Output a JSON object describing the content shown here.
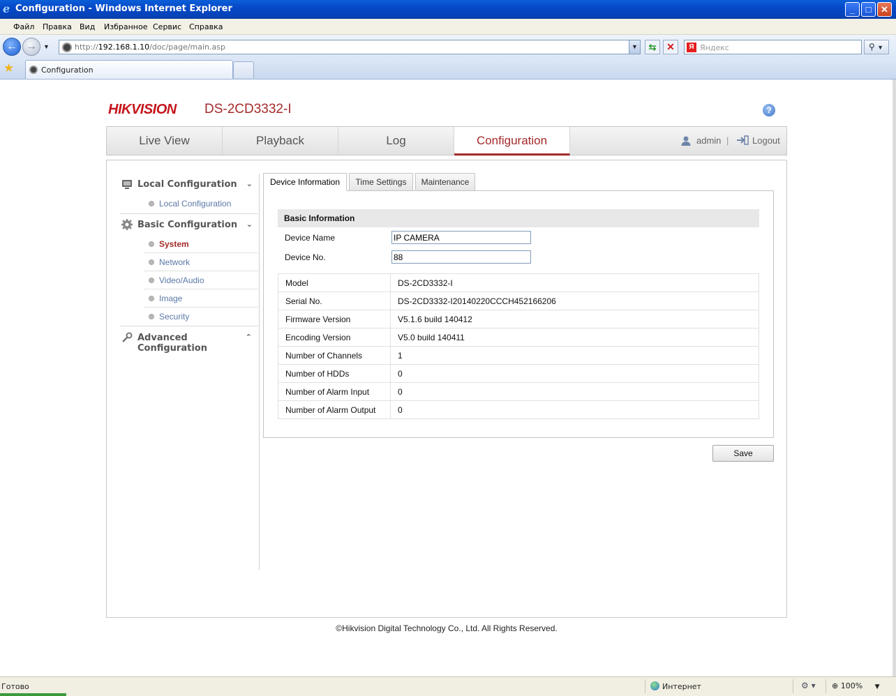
{
  "window": {
    "title": "Configuration - Windows Internet Explorer",
    "minimize": "_",
    "maximize": "□",
    "close": "✕"
  },
  "menu": [
    "Файл",
    "Правка",
    "Вид",
    "Избранное",
    "Сервис",
    "Справка"
  ],
  "address": {
    "prefix": "http://",
    "host": "192.168.1.10",
    "path": "/doc/page/main.asp",
    "search_placeholder": "Яндекс",
    "search_engine_letter": "Я"
  },
  "browser_tab": {
    "label": "Configuration"
  },
  "header": {
    "logo": "HIKVISION",
    "model": "DS-2CD3332-I",
    "help": "?"
  },
  "nav": {
    "tabs": [
      "Live View",
      "Playback",
      "Log",
      "Configuration"
    ],
    "active_index": 3,
    "user": "admin",
    "separator": "|",
    "logout": "Logout"
  },
  "sidebar": {
    "local": {
      "label": "Local Configuration",
      "items": [
        "Local Configuration"
      ]
    },
    "basic": {
      "label": "Basic Configuration",
      "items": [
        "System",
        "Network",
        "Video/Audio",
        "Image",
        "Security"
      ],
      "active": "System"
    },
    "advanced": {
      "label": "Advanced Configuration"
    }
  },
  "subtabs": [
    "Device Information",
    "Time Settings",
    "Maintenance"
  ],
  "basic_info": {
    "heading": "Basic Information",
    "device_name_label": "Device Name",
    "device_name_value": "IP CAMERA",
    "device_no_label": "Device No.",
    "device_no_value": "88"
  },
  "info_rows": [
    {
      "label": "Model",
      "value": "DS-2CD3332-I"
    },
    {
      "label": "Serial No.",
      "value": "DS-2CD3332-I20140220CCCH452166206"
    },
    {
      "label": "Firmware Version",
      "value": "V5.1.6 build 140412"
    },
    {
      "label": "Encoding Version",
      "value": "V5.0 build 140411"
    },
    {
      "label": "Number of Channels",
      "value": "1"
    },
    {
      "label": "Number of HDDs",
      "value": "0"
    },
    {
      "label": "Number of Alarm Input",
      "value": "0"
    },
    {
      "label": "Number of Alarm Output",
      "value": "0"
    }
  ],
  "save_label": "Save",
  "footer": "©Hikvision Digital Technology Co., Ltd. All Rights Reserved.",
  "status": {
    "text": "Готово",
    "zone": "Интернет",
    "zoom": "100%"
  },
  "colors": {
    "brand_red": "#c4161c",
    "accent": "#a52a2a",
    "link_blue": "#5a78a8"
  }
}
